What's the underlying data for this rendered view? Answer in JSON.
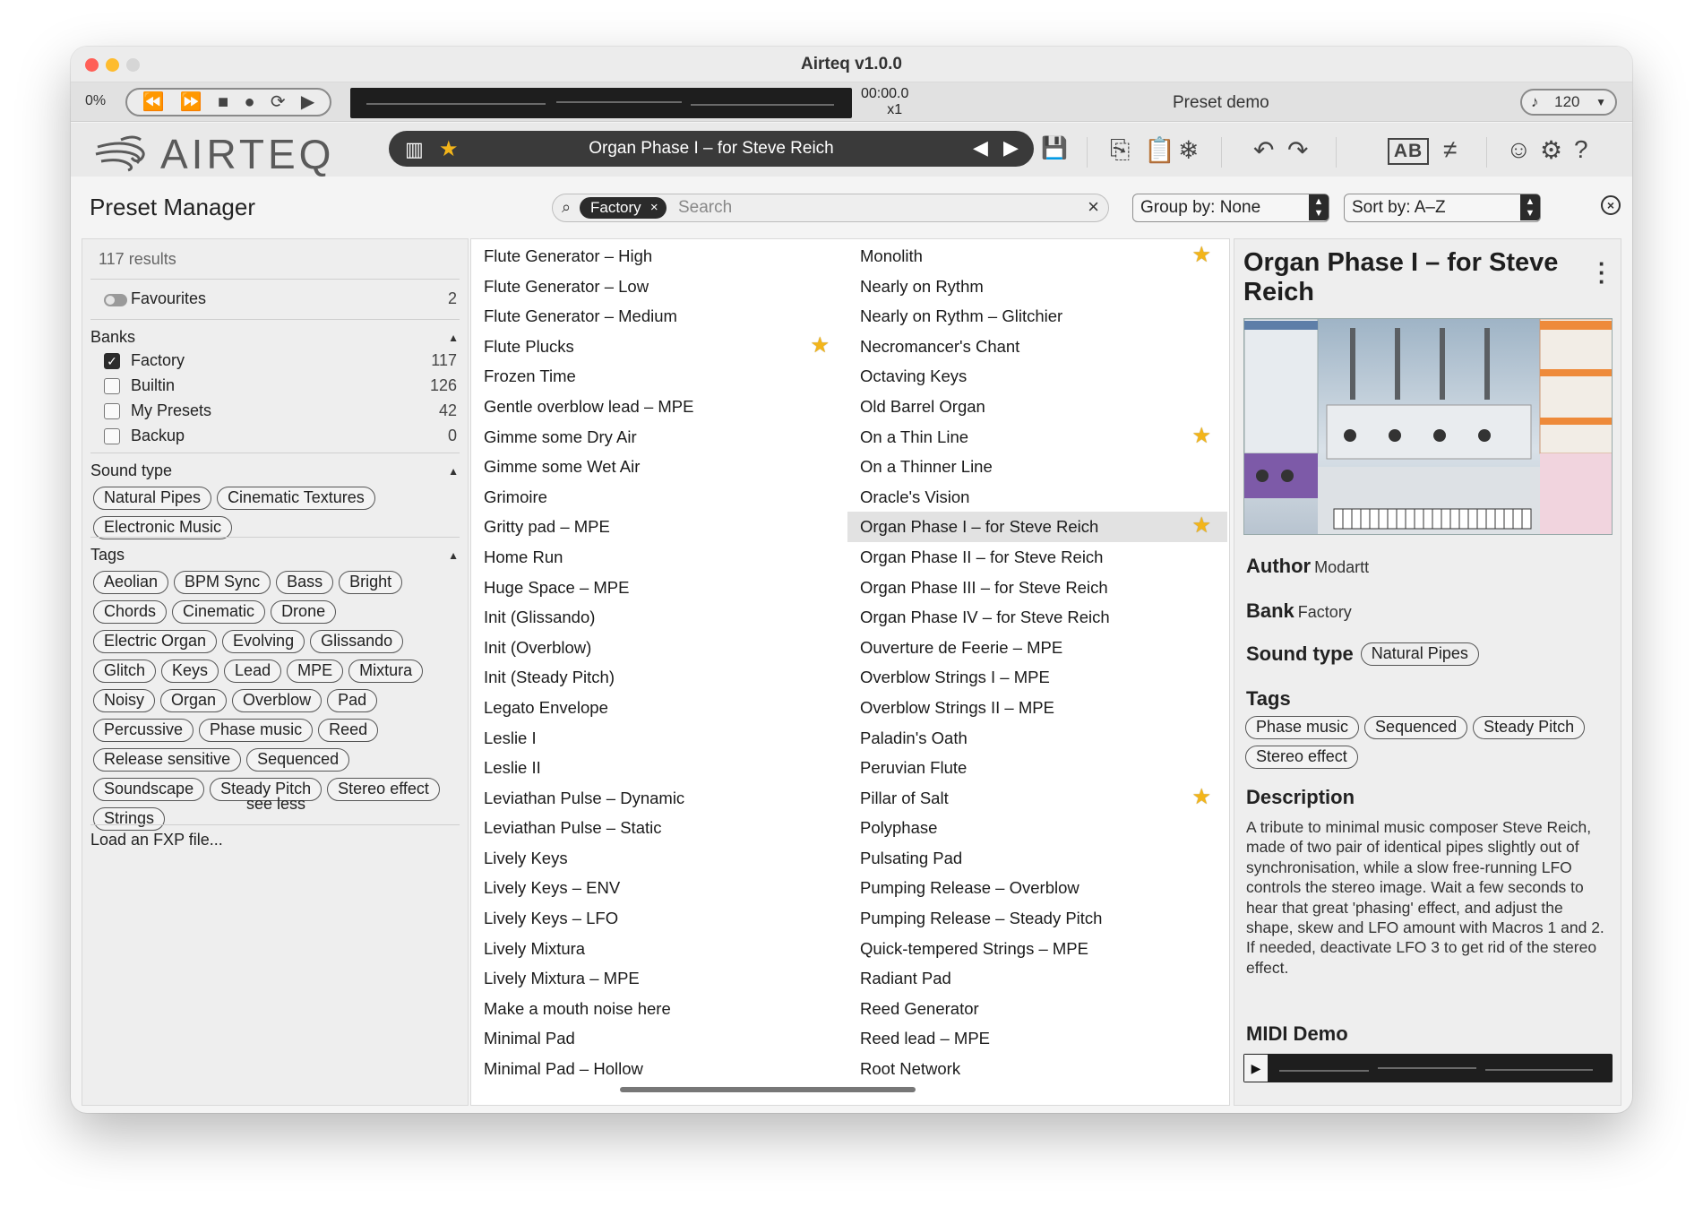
{
  "window": {
    "title": "Airteq v1.0.0"
  },
  "transport": {
    "cpu": "0%",
    "time": "00:00.0",
    "multiplier": "x1",
    "preset_demo": "Preset demo",
    "tempo": "120"
  },
  "header": {
    "logo_text": "AIRTEQ",
    "current_preset": "Organ Phase I – for Steve Reich",
    "ab_label": "AB"
  },
  "preset_manager": {
    "title": "Preset Manager",
    "search": {
      "chip": "Factory",
      "placeholder": "Search"
    },
    "group_by": "Group by: None",
    "sort_by": "Sort by: A–Z"
  },
  "filters": {
    "results": "117 results",
    "favourites": {
      "label": "Favourites",
      "count": "2"
    },
    "banks_title": "Banks",
    "banks": [
      {
        "label": "Factory",
        "count": "117",
        "checked": true
      },
      {
        "label": "Builtin",
        "count": "126",
        "checked": false
      },
      {
        "label": "My Presets",
        "count": "42",
        "checked": false
      },
      {
        "label": "Backup",
        "count": "0",
        "checked": false
      }
    ],
    "sound_type_title": "Sound type",
    "sound_types": [
      "Natural Pipes",
      "Cinematic Textures",
      "Electronic Music"
    ],
    "tags_title": "Tags",
    "tags": [
      "Aeolian",
      "BPM Sync",
      "Bass",
      "Bright",
      "Chords",
      "Cinematic",
      "Drone",
      "Electric Organ",
      "Evolving",
      "Glissando",
      "Glitch",
      "Keys",
      "Lead",
      "MPE",
      "Mixtura",
      "Noisy",
      "Organ",
      "Overblow",
      "Pad",
      "Percussive",
      "Phase music",
      "Reed",
      "Release sensitive",
      "Sequenced",
      "Soundscape",
      "Steady Pitch",
      "Stereo effect",
      "Strings"
    ],
    "see_less": "see less",
    "load_fxp": "Load an FXP file..."
  },
  "preset_list": {
    "column1": [
      {
        "name": "Flute Generator – High",
        "fav": false
      },
      {
        "name": "Flute Generator – Low",
        "fav": false
      },
      {
        "name": "Flute Generator – Medium",
        "fav": false
      },
      {
        "name": "Flute Plucks",
        "fav": true
      },
      {
        "name": "Frozen Time",
        "fav": false
      },
      {
        "name": "Gentle overblow lead – MPE",
        "fav": false
      },
      {
        "name": "Gimme some Dry Air",
        "fav": false
      },
      {
        "name": "Gimme some Wet Air",
        "fav": false
      },
      {
        "name": "Grimoire",
        "fav": false
      },
      {
        "name": "Gritty pad – MPE",
        "fav": false
      },
      {
        "name": "Home Run",
        "fav": false
      },
      {
        "name": "Huge Space – MPE",
        "fav": false
      },
      {
        "name": "Init (Glissando)",
        "fav": false
      },
      {
        "name": "Init (Overblow)",
        "fav": false
      },
      {
        "name": "Init (Steady Pitch)",
        "fav": false
      },
      {
        "name": "Legato Envelope",
        "fav": false
      },
      {
        "name": "Leslie I",
        "fav": false
      },
      {
        "name": "Leslie II",
        "fav": false
      },
      {
        "name": "Leviathan Pulse – Dynamic",
        "fav": false
      },
      {
        "name": "Leviathan Pulse – Static",
        "fav": false
      },
      {
        "name": "Lively Keys",
        "fav": false
      },
      {
        "name": "Lively Keys – ENV",
        "fav": false
      },
      {
        "name": "Lively Keys – LFO",
        "fav": false
      },
      {
        "name": "Lively Mixtura",
        "fav": false
      },
      {
        "name": "Lively Mixtura – MPE",
        "fav": false
      },
      {
        "name": "Make a mouth noise here",
        "fav": false
      },
      {
        "name": "Minimal Pad",
        "fav": false
      },
      {
        "name": "Minimal Pad – Hollow",
        "fav": false
      }
    ],
    "column2": [
      {
        "name": "Monolith",
        "fav": true
      },
      {
        "name": "Nearly on Rythm",
        "fav": false
      },
      {
        "name": "Nearly on Rythm – Glitchier",
        "fav": false
      },
      {
        "name": "Necromancer's Chant",
        "fav": false
      },
      {
        "name": "Octaving Keys",
        "fav": false
      },
      {
        "name": "Old Barrel Organ",
        "fav": false
      },
      {
        "name": "On a Thin Line",
        "fav": true
      },
      {
        "name": "On a Thinner Line",
        "fav": false
      },
      {
        "name": "Oracle's Vision",
        "fav": false
      },
      {
        "name": "Organ Phase I – for Steve Reich",
        "fav": true,
        "selected": true
      },
      {
        "name": "Organ Phase II – for Steve Reich",
        "fav": false
      },
      {
        "name": "Organ Phase III – for Steve Reich",
        "fav": false
      },
      {
        "name": "Organ Phase IV – for Steve Reich",
        "fav": false
      },
      {
        "name": "Ouverture de Feerie – MPE",
        "fav": false
      },
      {
        "name": "Overblow Strings I – MPE",
        "fav": false
      },
      {
        "name": "Overblow Strings II – MPE",
        "fav": false
      },
      {
        "name": "Paladin's Oath",
        "fav": false
      },
      {
        "name": "Peruvian Flute",
        "fav": false
      },
      {
        "name": "Pillar of Salt",
        "fav": true
      },
      {
        "name": "Polyphase",
        "fav": false
      },
      {
        "name": "Pulsating Pad",
        "fav": false
      },
      {
        "name": "Pumping Release – Overblow",
        "fav": false
      },
      {
        "name": "Pumping Release – Steady Pitch",
        "fav": false
      },
      {
        "name": "Quick-tempered Strings – MPE",
        "fav": false
      },
      {
        "name": "Radiant Pad",
        "fav": false
      },
      {
        "name": "Reed Generator",
        "fav": false
      },
      {
        "name": "Reed lead – MPE",
        "fav": false
      },
      {
        "name": "Root Network",
        "fav": false
      }
    ]
  },
  "detail": {
    "title": "Organ Phase I – for Steve Reich",
    "author_label": "Author",
    "author": "Modartt",
    "bank_label": "Bank",
    "bank": "Factory",
    "sound_type_label": "Sound type",
    "sound_type": "Natural Pipes",
    "tags_label": "Tags",
    "tags": [
      "Phase music",
      "Sequenced",
      "Steady Pitch",
      "Stereo effect"
    ],
    "description_label": "Description",
    "description": "A tribute to minimal music composer Steve Reich, made of two pair of identical pipes slightly out of synchronisation, while a slow free-running LFO controls the stereo image. Wait a few seconds to hear that great 'phasing' effect, and adjust the shape, skew and LFO amount with Macros 1 and 2. If needed, deactivate LFO 3 to get rid of the stereo effect.",
    "midi_label": "MIDI Demo"
  },
  "colors": {
    "favourite_star": "#f3b51a",
    "selected_row": "#e2e2e2",
    "dark_bar": "#3a3a3a"
  }
}
